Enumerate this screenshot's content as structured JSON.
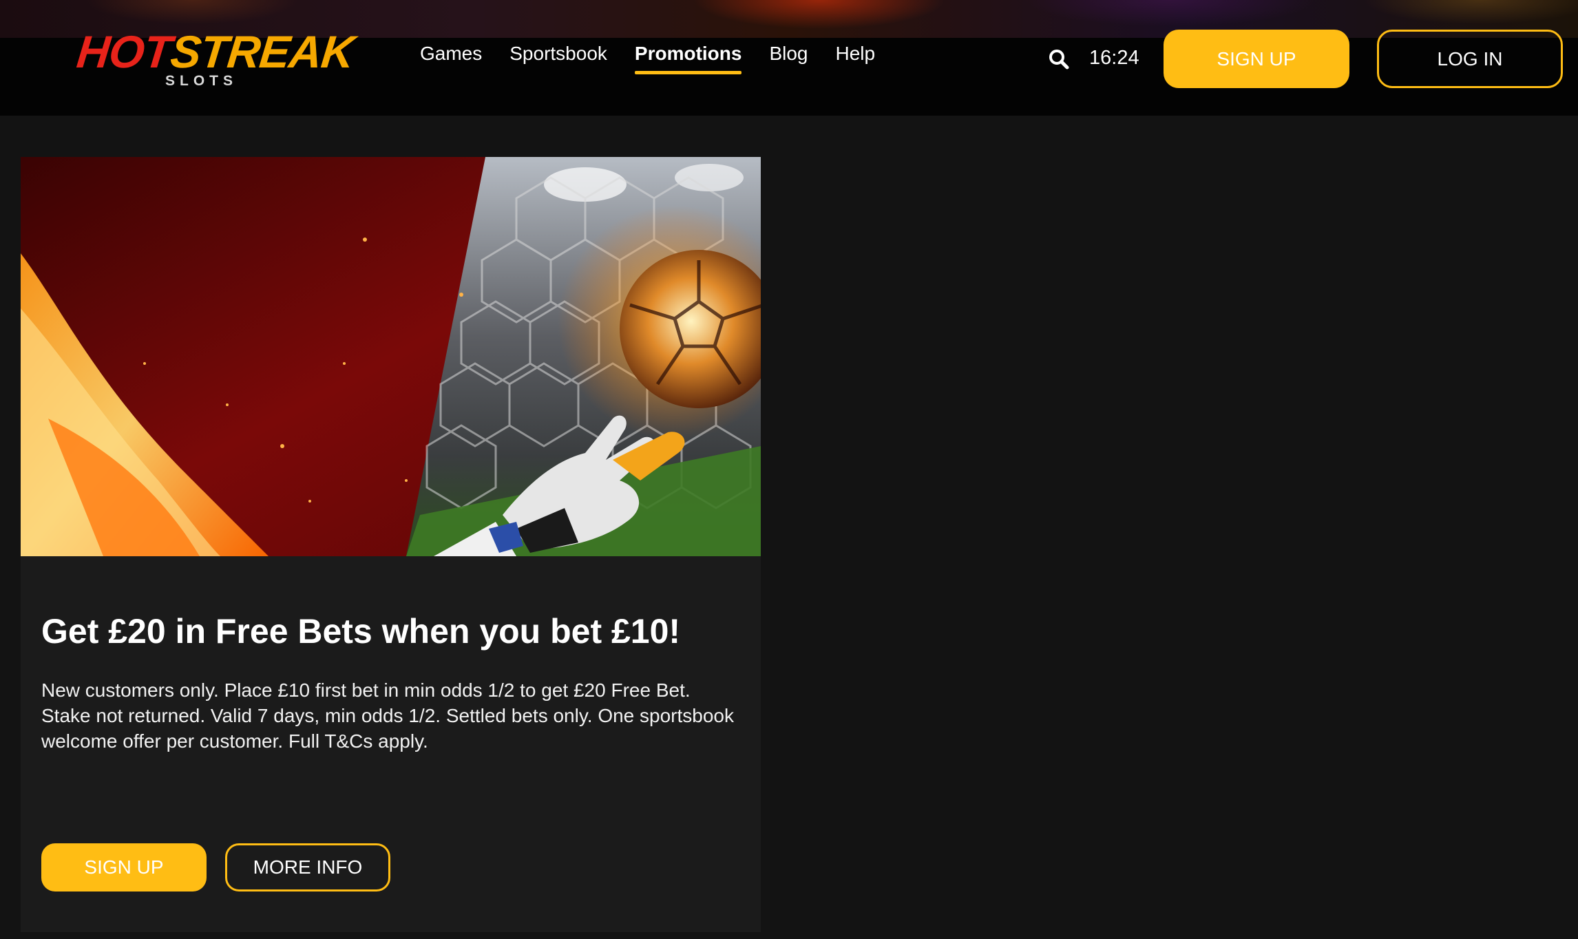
{
  "brand": {
    "logo_hot": "HOT",
    "logo_streak": "STREAK",
    "logo_sub": "SLOTS"
  },
  "nav": {
    "items": [
      {
        "label": "Games",
        "active": false
      },
      {
        "label": "Sportsbook",
        "active": false
      },
      {
        "label": "Promotions",
        "active": true
      },
      {
        "label": "Blog",
        "active": false
      },
      {
        "label": "Help",
        "active": false
      }
    ]
  },
  "header": {
    "search_icon": "search-icon",
    "time": "16:24",
    "signup_label": "SIGN UP",
    "login_label": "LOG IN"
  },
  "promo": {
    "image_desc_icon": "banner-image",
    "title": "Get £20 in Free Bets when you bet £10!",
    "description": "New customers only. Place £10 first bet in min odds 1/2 to get £20 Free Bet. Stake not returned. Valid 7 days, min odds 1/2. Settled bets only. One sportsbook welcome offer per customer. Full T&Cs apply.",
    "signup_label": "SIGN UP",
    "more_info_label": "MORE INFO"
  },
  "colors": {
    "accent": "#ffbd14",
    "background": "#131313",
    "card": "#1b1b1b",
    "header": "#030303",
    "logo_red": "#e8231a",
    "logo_orange": "#f6a800"
  }
}
